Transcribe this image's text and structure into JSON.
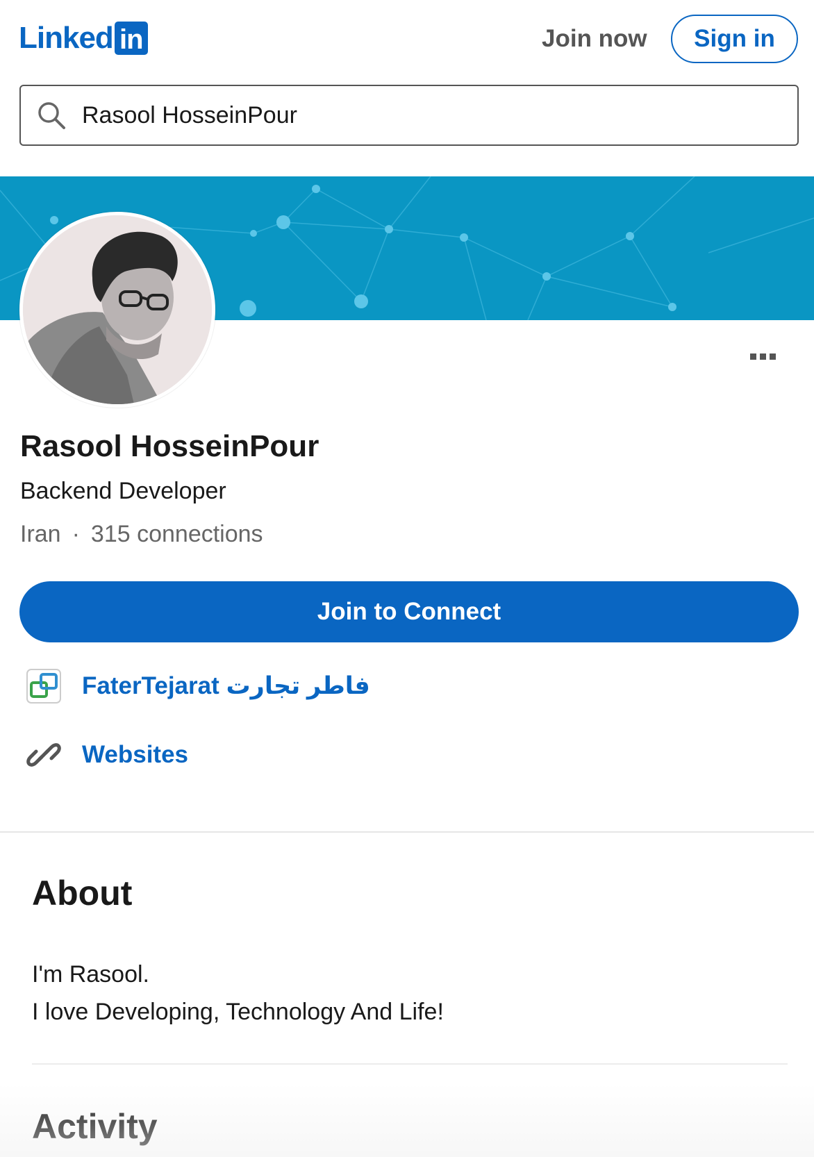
{
  "header": {
    "logo_text": "Linked",
    "logo_box_text": "in",
    "join_now_label": "Join now",
    "sign_in_label": "Sign in"
  },
  "search": {
    "value": "Rasool HosseinPour",
    "icon": "search-icon"
  },
  "profile": {
    "name": "Rasool HosseinPour",
    "headline": "Backend Developer",
    "location": "Iran",
    "separator": "·",
    "connections": "315 connections",
    "connect_button_label": "Join to Connect",
    "more_icon": "more-options-icon"
  },
  "links": {
    "company": "FaterTejarat فاطر تجارت",
    "websites": "Websites"
  },
  "about": {
    "title": "About",
    "line1": "I'm Rasool.",
    "line2": "I love Developing, Technology And Life!"
  },
  "activity": {
    "title": "Activity"
  },
  "colors": {
    "brand": "#0a66c2",
    "cover": "#0a96c3",
    "muted_text": "#666666"
  }
}
